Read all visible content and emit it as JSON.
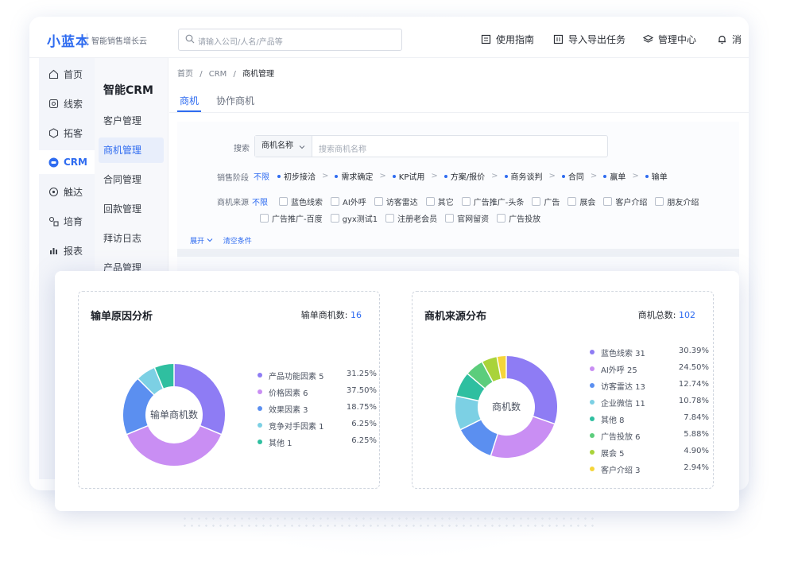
{
  "brand": {
    "logo": "小蓝本",
    "slogan": "智能销售增长云"
  },
  "search": {
    "placeholder": "请输入公司/人名/产品等"
  },
  "topnav": [
    {
      "label": "使用指南",
      "icon": "guide-icon"
    },
    {
      "label": "导入导出任务",
      "icon": "import-export-icon"
    },
    {
      "label": "管理中心",
      "icon": "layers-icon"
    },
    {
      "label": "消",
      "icon": "bell-icon"
    }
  ],
  "sidebar": {
    "items": [
      {
        "label": "首页",
        "icon": "home-icon"
      },
      {
        "label": "线索",
        "icon": "leads-icon"
      },
      {
        "label": "拓客",
        "icon": "cube-icon"
      },
      {
        "label": "CRM",
        "icon": "crm-icon"
      },
      {
        "label": "触达",
        "icon": "reach-icon"
      },
      {
        "label": "培育",
        "icon": "nurture-icon"
      },
      {
        "label": "报表",
        "icon": "chart-icon"
      }
    ],
    "active": "CRM"
  },
  "submenu": {
    "title": "智能CRM",
    "items": [
      "客户管理",
      "商机管理",
      "合同管理",
      "回款管理",
      "拜访日志",
      "产品管理"
    ],
    "active": "商机管理"
  },
  "breadcrumb": {
    "items": [
      "首页",
      "CRM"
    ],
    "current": "商机管理",
    "sep": "/"
  },
  "tabs": [
    "商机",
    "协作商机"
  ],
  "filters": {
    "search_label": "搜索",
    "search_field": "商机名称",
    "search_placeholder": "搜索商机名称",
    "stage_label": "销售阶段",
    "unlimited": "不限",
    "stages": [
      "初步接洽",
      "需求确定",
      "KP试用",
      "方案/报价",
      "商务谈判",
      "合同",
      "赢单",
      "输单"
    ],
    "source_label": "商机来源",
    "sources_row1": [
      "蓝色线索",
      "AI外呼",
      "访客雷达",
      "其它",
      "广告推广-头条",
      "广告",
      "展会",
      "客户介绍",
      "朋友介绍"
    ],
    "sources_row2": [
      "广告推广-百度",
      "gyx测试1",
      "注册老会员",
      "官网留资",
      "广告投放"
    ],
    "expand": "展开",
    "clear": "清空条件"
  },
  "panels": {
    "loss": {
      "title": "输单原因分析",
      "count_label": "输单商机数:",
      "count": "16",
      "center": "输单商机数"
    },
    "source": {
      "title": "商机来源分布",
      "count_label": "商机总数:",
      "count": "102",
      "center": "商机数"
    }
  },
  "chart_data": [
    {
      "type": "pie",
      "title": "输单原因分析",
      "categories": [
        "产品功能因素",
        "价格因素",
        "效果因素",
        "竞争对手因素",
        "其他"
      ],
      "values": [
        5,
        6,
        3,
        1,
        1
      ],
      "percents": [
        "31.25%",
        "37.50%",
        "18.75%",
        "6.25%",
        "6.25%"
      ],
      "colors": [
        "#8e7cf4",
        "#c98ef3",
        "#5b8ff0",
        "#7cd0e4",
        "#2fbfa0"
      ]
    },
    {
      "type": "pie",
      "title": "商机来源分布",
      "categories": [
        "蓝色线索",
        "AI外呼",
        "访客雷达",
        "企业微信",
        "其他",
        "广告投放",
        "展会",
        "客户介绍"
      ],
      "values": [
        31,
        25,
        13,
        11,
        8,
        6,
        5,
        3
      ],
      "percents": [
        "30.39%",
        "24.50%",
        "12.74%",
        "10.78%",
        "7.84%",
        "5.88%",
        "4.90%",
        "2.94%"
      ],
      "colors": [
        "#8e7cf4",
        "#c98ef3",
        "#5b8ff0",
        "#7cd0e4",
        "#2fbfa0",
        "#5ccd7c",
        "#a9d33a",
        "#f5d53a"
      ]
    }
  ]
}
